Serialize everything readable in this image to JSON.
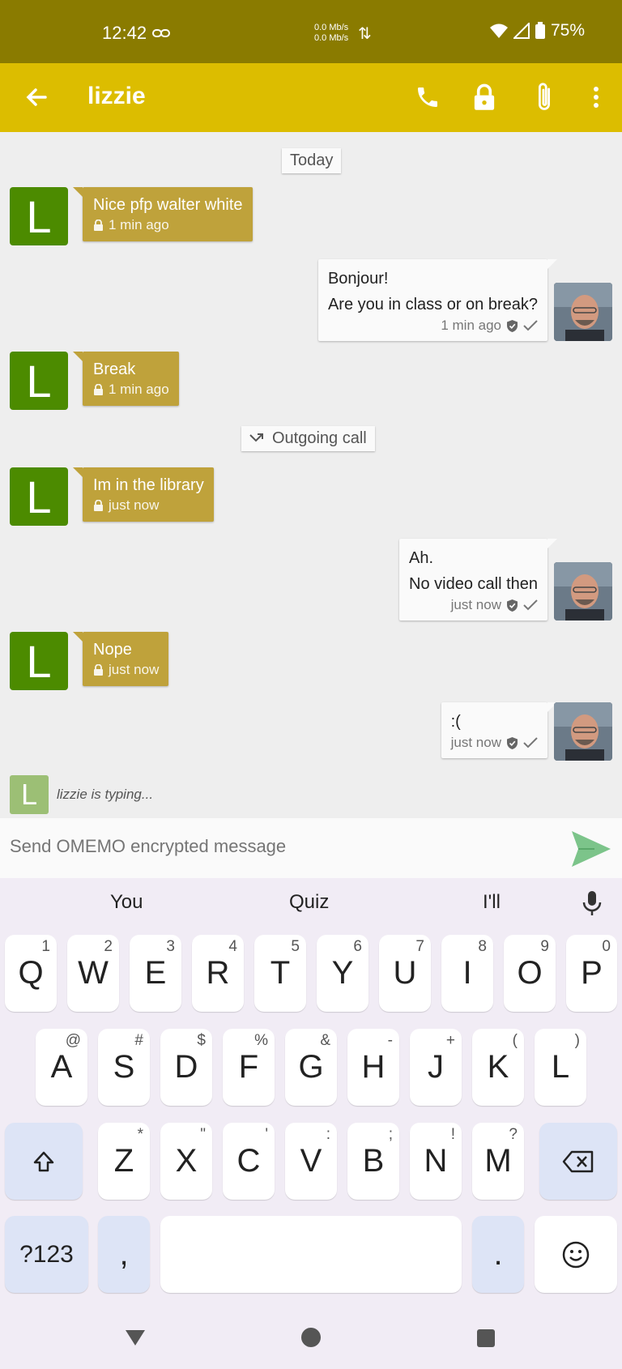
{
  "status_bar": {
    "time": "12:42",
    "net_up": "0.0 Mb/s",
    "net_down": "0.0 Mb/s",
    "battery": "75%"
  },
  "app_bar": {
    "title": "lizzie",
    "icons": [
      "back-arrow-icon",
      "phone-icon",
      "lock-icon",
      "paperclip-icon",
      "more-vert-icon"
    ]
  },
  "chat": {
    "date_label": "Today",
    "call_label": "Outgoing call",
    "contact_initial": "L",
    "messages": [
      {
        "dir": "in",
        "lines": [
          "Nice pfp walter white"
        ],
        "time": "1 min ago"
      },
      {
        "dir": "out",
        "lines": [
          "Bonjour!",
          "Are you in class or on break?"
        ],
        "time": "1 min ago"
      },
      {
        "dir": "in",
        "lines": [
          "Break"
        ],
        "time": "1 min ago"
      },
      {
        "dir": "in",
        "lines": [
          "Im in the library"
        ],
        "time": "just now"
      },
      {
        "dir": "out",
        "lines": [
          "Ah.",
          "No video call then"
        ],
        "time": "just now"
      },
      {
        "dir": "in",
        "lines": [
          "Nope"
        ],
        "time": "just now"
      },
      {
        "dir": "out",
        "lines": [
          ":("
        ],
        "time": "just now"
      }
    ],
    "typing": "lizzie is typing..."
  },
  "composer": {
    "placeholder": "Send OMEMO encrypted message"
  },
  "keyboard": {
    "suggestions": [
      "You",
      "Quiz",
      "I'll"
    ],
    "row1": [
      [
        "Q",
        "1"
      ],
      [
        "W",
        "2"
      ],
      [
        "E",
        "3"
      ],
      [
        "R",
        "4"
      ],
      [
        "T",
        "5"
      ],
      [
        "Y",
        "6"
      ],
      [
        "U",
        "7"
      ],
      [
        "I",
        "8"
      ],
      [
        "O",
        "9"
      ],
      [
        "P",
        "0"
      ]
    ],
    "row2": [
      [
        "A",
        "@"
      ],
      [
        "S",
        "#"
      ],
      [
        "D",
        "$"
      ],
      [
        "F",
        "%"
      ],
      [
        "G",
        "&"
      ],
      [
        "H",
        "-"
      ],
      [
        "J",
        "+"
      ],
      [
        "K",
        "("
      ],
      [
        "L",
        ")"
      ]
    ],
    "row3": [
      [
        "Z",
        "*"
      ],
      [
        "X",
        "\""
      ],
      [
        "C",
        "'"
      ],
      [
        "V",
        ":"
      ],
      [
        "B",
        ";"
      ],
      [
        "N",
        "!"
      ],
      [
        "M",
        "?"
      ]
    ],
    "sym_label": "?123",
    "comma": ",",
    "period": "."
  },
  "colors": {
    "status_bar": "#8a7b00",
    "app_bar": "#dcbd00",
    "incoming_bubble": "#bfa23b",
    "avatar": "#4c8b00",
    "send": "#7cc48a"
  }
}
